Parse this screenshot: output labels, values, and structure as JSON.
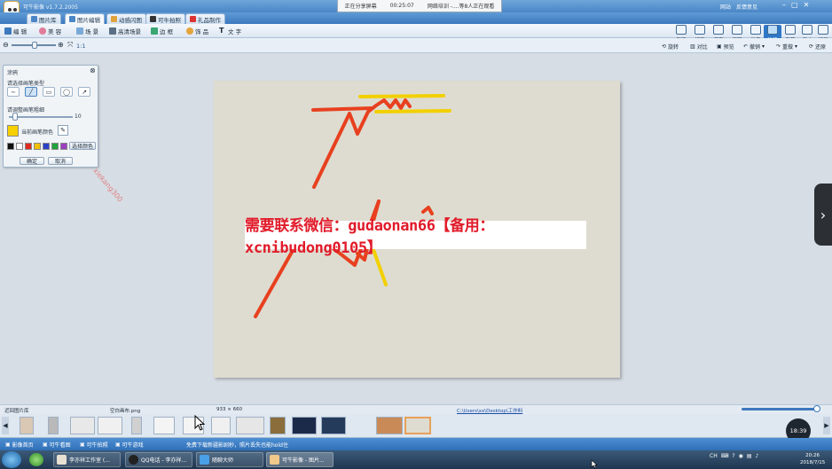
{
  "app": {
    "title": "可牛影像 v1.7.2.2005",
    "window_links": [
      "网站",
      "反馈意见"
    ],
    "window_controls": [
      "–",
      "▢",
      "✕"
    ]
  },
  "share_bar": {
    "status": "正在分享屏幕",
    "timer": "00:25:07",
    "viewers": "网络培训 -....等8人正在观看"
  },
  "tabs": [
    {
      "label": "图片库"
    },
    {
      "label": "图片编辑"
    },
    {
      "label": "动感闪图"
    },
    {
      "label": "可牛拍照"
    },
    {
      "label": "礼品制作"
    }
  ],
  "toolbar": {
    "items": [
      "编 辑",
      "美 容",
      "场 景",
      "高清场景",
      "边 框",
      "饰 品",
      "文 字"
    ]
  },
  "right_buttons": [
    "新建",
    "打开",
    "保存",
    "抠图",
    "批量",
    "涂鸦",
    "裁剪",
    "尺寸",
    "打印"
  ],
  "zoom": {
    "fit_label": "1:1"
  },
  "edit_tools": [
    "旋转",
    "对比",
    "预览",
    "撤销",
    "重做",
    "还原"
  ],
  "brush_panel": {
    "title": "涂鸦",
    "type_label": "请选择画笔类型",
    "size_label": "请调整画笔粗细",
    "size_value": "10",
    "current_color_label": "当前画笔颜色",
    "pick_color_label": "选择颜色",
    "ok_label": "确定",
    "cancel_label": "取消",
    "shapes": [
      "∼",
      "╱",
      "▭",
      "◯",
      "↗"
    ],
    "swatches": [
      "#111111",
      "#ffffff",
      "#e02a1f",
      "#f2c100",
      "#2a41c8",
      "#1fa33a",
      "#9b3fc0"
    ],
    "current_color": "#f6d000"
  },
  "watermark": {
    "text": "xiekang300"
  },
  "banner": {
    "text": "需要联系微信：gudaonan66【备用：xcnibudong0105】"
  },
  "infobar": {
    "left": "近回图片库",
    "filename": "空白画布.png",
    "dims": "933 × 660",
    "path": "C:\\Users\\xx\\Desktop\\工作料"
  },
  "badge": {
    "time": "18:39"
  },
  "statusbar": {
    "items": [
      "影像首页",
      "可牛看图",
      "可牛拍照",
      "可牛游戏"
    ],
    "message": "免费下载新疆影剧秒，照片丢失也能hold住"
  },
  "taskbar": {
    "tasks": [
      "李亦祥工作室 (...",
      "QQ电话 - 李亦祥...",
      "随聊大师",
      "可牛影像 - 图片..."
    ],
    "tray": "CH",
    "time": "20:26",
    "date": "2018/7/15"
  },
  "colors": {
    "stroke_red": "#e8401f",
    "stroke_yellow": "#f2d000",
    "accent": "#2f77c6"
  }
}
